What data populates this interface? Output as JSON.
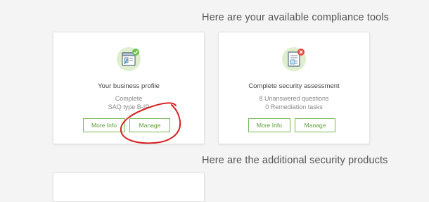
{
  "sections": {
    "tools_heading": "Here are your available compliance tools",
    "products_heading": "Here are the additional security products"
  },
  "cards": [
    {
      "title": "Your business profile",
      "lines": [
        "Complete",
        "SAQ type B-IP"
      ],
      "status": "complete",
      "status_color": "#6cc04a",
      "icon": "business-profile-icon",
      "more_label": "More Info",
      "manage_label": "Manage"
    },
    {
      "title": "Complete security assessment",
      "lines": [
        "8 Unanswered questions",
        "0 Remediation tasks"
      ],
      "status": "incomplete",
      "status_color": "#e64a3b",
      "icon": "security-assessment-icon",
      "more_label": "More Info",
      "manage_label": "Manage"
    }
  ],
  "colors": {
    "accent": "#76b852",
    "annotation": "#d62020"
  }
}
